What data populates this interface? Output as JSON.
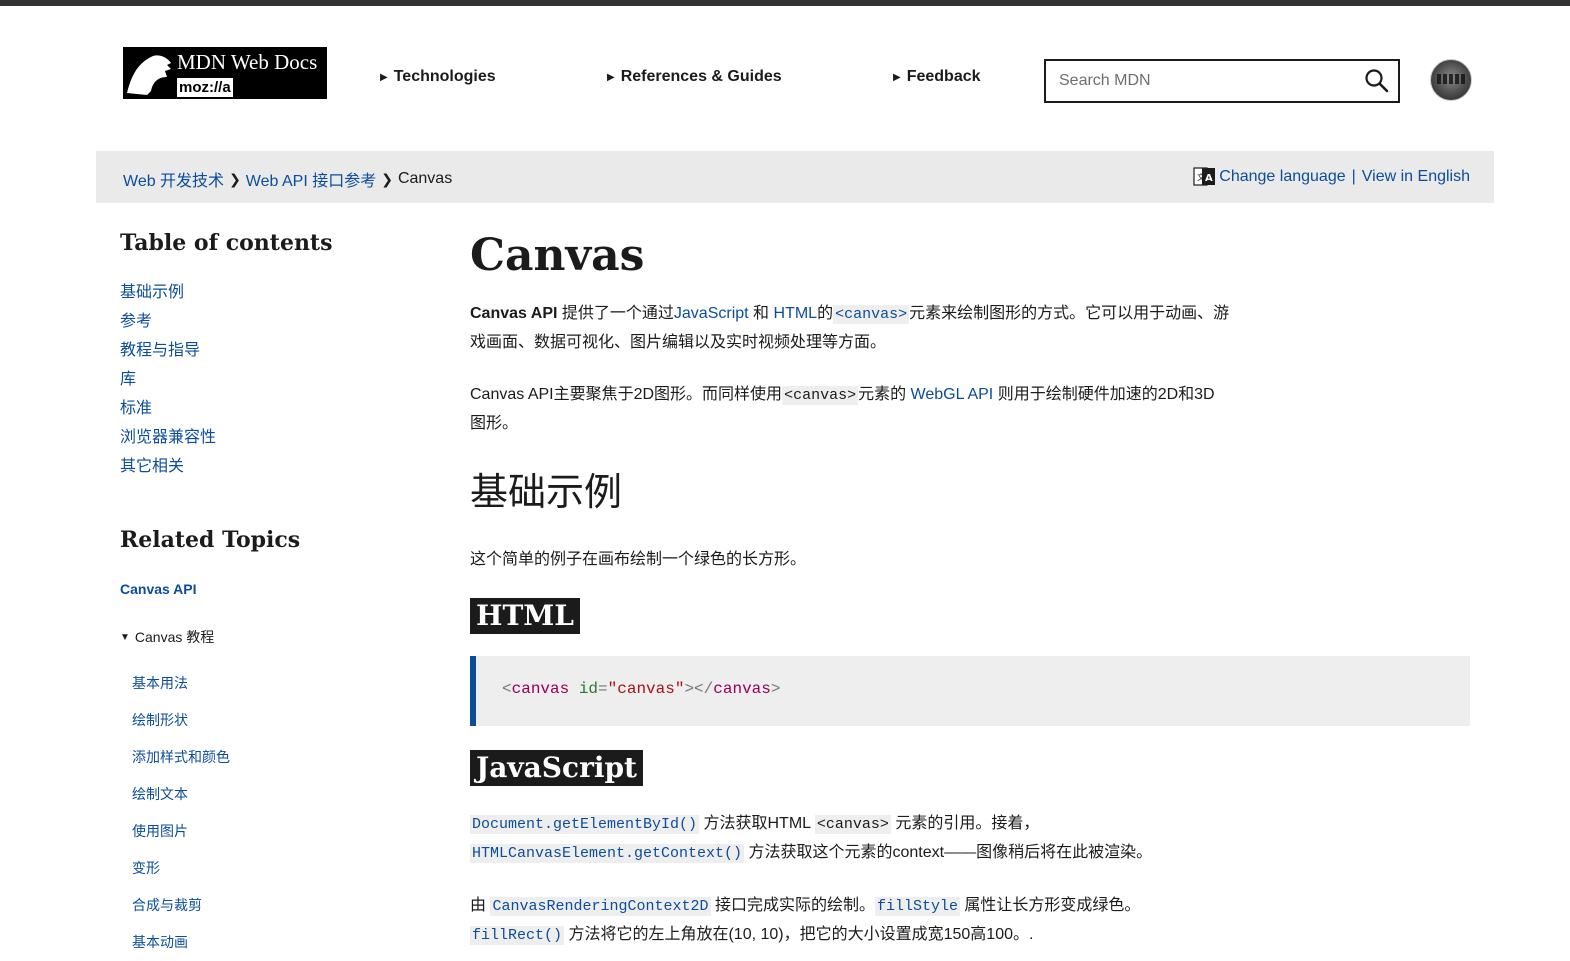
{
  "header": {
    "logo_title": "MDN Web Docs",
    "logo_sub": "moz://a",
    "nav": [
      "Technologies",
      "References & Guides",
      "Feedback"
    ],
    "search_placeholder": "Search MDN"
  },
  "breadcrumb": {
    "items": [
      "Web 开发技术",
      "Web API 接口参考",
      "Canvas"
    ],
    "change_language": "Change language",
    "separator": "|",
    "view_english": "View in English"
  },
  "sidebar": {
    "toc_title": "Table of contents",
    "toc": [
      "基础示例",
      "参考",
      "教程与指导",
      "库",
      "标准",
      "浏览器兼容性",
      "其它相关"
    ],
    "related_title": "Related Topics",
    "related_main": "Canvas API",
    "tutorial_label": "Canvas 教程",
    "tutorial_items": [
      "基本用法",
      "绘制形状",
      "添加样式和颜色",
      "绘制文本",
      "使用图片",
      "变形",
      "合成与裁剪",
      "基本动画"
    ]
  },
  "main": {
    "title": "Canvas",
    "intro": {
      "strong": "Canvas API",
      "t1": " 提供了一个通过",
      "link_js": "JavaScript",
      "t2": " 和 ",
      "link_html": "HTML",
      "t3": "的",
      "link_canvas": "<canvas>",
      "t4": "元素来绘制图形的方式。它可以用于动画、游戏画面、数据可视化、图片编辑以及实时视频处理等方面。"
    },
    "para2": {
      "t1": "Canvas API主要聚焦于2D图形。而同样使用",
      "code": "<canvas>",
      "t2": "元素的 ",
      "link": "WebGL API",
      "t3": " 则用于绘制硬件加速的2D和3D图形。"
    },
    "h2_basic": "基础示例",
    "basic_desc": "这个简单的例子在画布绘制一个绿色的长方形。",
    "h3_html": "HTML",
    "code_html": {
      "tag": "canvas",
      "attr": "id",
      "value": "\"canvas\""
    },
    "h3_js": "JavaScript",
    "js_p1": {
      "link1": "Document.getElementById()",
      "t1": " 方法获取HTML ",
      "code": "<canvas>",
      "t2": " 元素的引用。接着，",
      "link2": "HTMLCanvasElement.getContext()",
      "t3": " 方法获取这个元素的context——图像稍后将在此被渲染。"
    },
    "js_p2": {
      "t0": "由 ",
      "link1": "CanvasRenderingContext2D",
      "t1": " 接口完成实际的绘制。",
      "link2": "fillStyle",
      "t2": " 属性让长方形变成绿色。",
      "link3": "fillRect()",
      "t3": " 方法将它的左上角放在(10, 10)，把它的大小设置成宽150高100。."
    }
  }
}
